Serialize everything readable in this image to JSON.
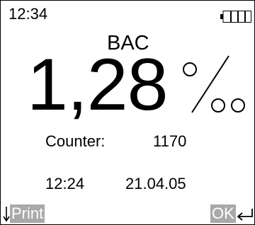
{
  "status_bar": {
    "time": "12:34",
    "battery_icon": "battery-icon",
    "battery_level": 0.25
  },
  "reading": {
    "mode_label": "BAC",
    "value": "1,28",
    "unit_icon": "permille-icon"
  },
  "info": {
    "counter_label": "Counter:",
    "counter_value": "1170",
    "test_time": "12:24",
    "test_date": "21.04.05"
  },
  "softkeys": {
    "left_label": "Print",
    "left_icon": "arrow-down-icon",
    "right_label": "OK",
    "right_icon": "enter-arrow-icon",
    "highlight_color": "#a9a9a9"
  }
}
